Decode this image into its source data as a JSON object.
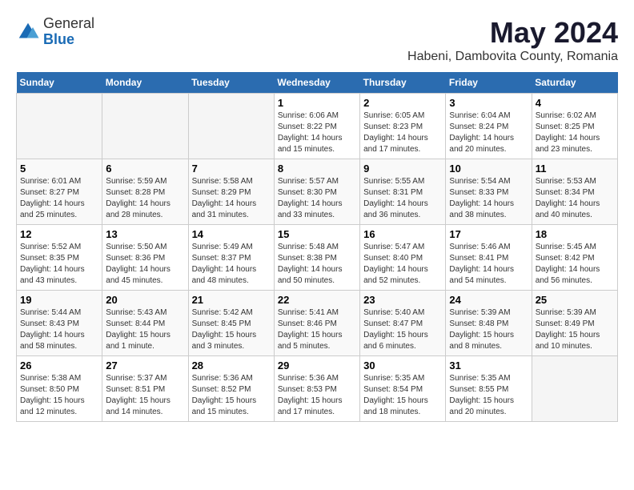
{
  "logo": {
    "general": "General",
    "blue": "Blue"
  },
  "title": {
    "month_year": "May 2024",
    "location": "Habeni, Dambovita County, Romania"
  },
  "days_of_week": [
    "Sunday",
    "Monday",
    "Tuesday",
    "Wednesday",
    "Thursday",
    "Friday",
    "Saturday"
  ],
  "weeks": [
    [
      {
        "day": "",
        "info": ""
      },
      {
        "day": "",
        "info": ""
      },
      {
        "day": "",
        "info": ""
      },
      {
        "day": "1",
        "info": "Sunrise: 6:06 AM\nSunset: 8:22 PM\nDaylight: 14 hours\nand 15 minutes."
      },
      {
        "day": "2",
        "info": "Sunrise: 6:05 AM\nSunset: 8:23 PM\nDaylight: 14 hours\nand 17 minutes."
      },
      {
        "day": "3",
        "info": "Sunrise: 6:04 AM\nSunset: 8:24 PM\nDaylight: 14 hours\nand 20 minutes."
      },
      {
        "day": "4",
        "info": "Sunrise: 6:02 AM\nSunset: 8:25 PM\nDaylight: 14 hours\nand 23 minutes."
      }
    ],
    [
      {
        "day": "5",
        "info": "Sunrise: 6:01 AM\nSunset: 8:27 PM\nDaylight: 14 hours\nand 25 minutes."
      },
      {
        "day": "6",
        "info": "Sunrise: 5:59 AM\nSunset: 8:28 PM\nDaylight: 14 hours\nand 28 minutes."
      },
      {
        "day": "7",
        "info": "Sunrise: 5:58 AM\nSunset: 8:29 PM\nDaylight: 14 hours\nand 31 minutes."
      },
      {
        "day": "8",
        "info": "Sunrise: 5:57 AM\nSunset: 8:30 PM\nDaylight: 14 hours\nand 33 minutes."
      },
      {
        "day": "9",
        "info": "Sunrise: 5:55 AM\nSunset: 8:31 PM\nDaylight: 14 hours\nand 36 minutes."
      },
      {
        "day": "10",
        "info": "Sunrise: 5:54 AM\nSunset: 8:33 PM\nDaylight: 14 hours\nand 38 minutes."
      },
      {
        "day": "11",
        "info": "Sunrise: 5:53 AM\nSunset: 8:34 PM\nDaylight: 14 hours\nand 40 minutes."
      }
    ],
    [
      {
        "day": "12",
        "info": "Sunrise: 5:52 AM\nSunset: 8:35 PM\nDaylight: 14 hours\nand 43 minutes."
      },
      {
        "day": "13",
        "info": "Sunrise: 5:50 AM\nSunset: 8:36 PM\nDaylight: 14 hours\nand 45 minutes."
      },
      {
        "day": "14",
        "info": "Sunrise: 5:49 AM\nSunset: 8:37 PM\nDaylight: 14 hours\nand 48 minutes."
      },
      {
        "day": "15",
        "info": "Sunrise: 5:48 AM\nSunset: 8:38 PM\nDaylight: 14 hours\nand 50 minutes."
      },
      {
        "day": "16",
        "info": "Sunrise: 5:47 AM\nSunset: 8:40 PM\nDaylight: 14 hours\nand 52 minutes."
      },
      {
        "day": "17",
        "info": "Sunrise: 5:46 AM\nSunset: 8:41 PM\nDaylight: 14 hours\nand 54 minutes."
      },
      {
        "day": "18",
        "info": "Sunrise: 5:45 AM\nSunset: 8:42 PM\nDaylight: 14 hours\nand 56 minutes."
      }
    ],
    [
      {
        "day": "19",
        "info": "Sunrise: 5:44 AM\nSunset: 8:43 PM\nDaylight: 14 hours\nand 58 minutes."
      },
      {
        "day": "20",
        "info": "Sunrise: 5:43 AM\nSunset: 8:44 PM\nDaylight: 15 hours\nand 1 minute."
      },
      {
        "day": "21",
        "info": "Sunrise: 5:42 AM\nSunset: 8:45 PM\nDaylight: 15 hours\nand 3 minutes."
      },
      {
        "day": "22",
        "info": "Sunrise: 5:41 AM\nSunset: 8:46 PM\nDaylight: 15 hours\nand 5 minutes."
      },
      {
        "day": "23",
        "info": "Sunrise: 5:40 AM\nSunset: 8:47 PM\nDaylight: 15 hours\nand 6 minutes."
      },
      {
        "day": "24",
        "info": "Sunrise: 5:39 AM\nSunset: 8:48 PM\nDaylight: 15 hours\nand 8 minutes."
      },
      {
        "day": "25",
        "info": "Sunrise: 5:39 AM\nSunset: 8:49 PM\nDaylight: 15 hours\nand 10 minutes."
      }
    ],
    [
      {
        "day": "26",
        "info": "Sunrise: 5:38 AM\nSunset: 8:50 PM\nDaylight: 15 hours\nand 12 minutes."
      },
      {
        "day": "27",
        "info": "Sunrise: 5:37 AM\nSunset: 8:51 PM\nDaylight: 15 hours\nand 14 minutes."
      },
      {
        "day": "28",
        "info": "Sunrise: 5:36 AM\nSunset: 8:52 PM\nDaylight: 15 hours\nand 15 minutes."
      },
      {
        "day": "29",
        "info": "Sunrise: 5:36 AM\nSunset: 8:53 PM\nDaylight: 15 hours\nand 17 minutes."
      },
      {
        "day": "30",
        "info": "Sunrise: 5:35 AM\nSunset: 8:54 PM\nDaylight: 15 hours\nand 18 minutes."
      },
      {
        "day": "31",
        "info": "Sunrise: 5:35 AM\nSunset: 8:55 PM\nDaylight: 15 hours\nand 20 minutes."
      },
      {
        "day": "",
        "info": ""
      }
    ]
  ]
}
